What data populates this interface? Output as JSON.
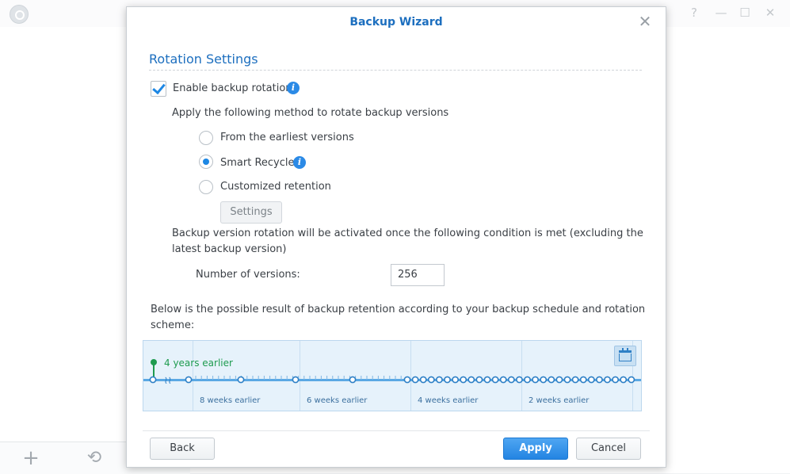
{
  "dialog": {
    "title": "Backup Wizard",
    "close_glyph": "✕",
    "section_title": "Rotation Settings",
    "enable_rotation_label": "Enable backup rotation",
    "enable_rotation_checked": true,
    "method_intro": "Apply the following method to rotate backup versions",
    "methods": [
      {
        "label": "From the earliest versions",
        "selected": false
      },
      {
        "label": "Smart Recycle",
        "selected": true
      },
      {
        "label": "Customized retention",
        "selected": false
      }
    ],
    "settings_button": "Settings",
    "condition_line1": "Backup version rotation will be activated once the following condition is met (excluding the",
    "condition_line2": "latest backup version)",
    "versions_label": "Number of versions:",
    "versions_value": "256",
    "result_line1": "Below is the possible result of backup retention according to your backup schedule and rotation",
    "result_line2": "scheme:",
    "timeline": {
      "earliest_label": "4 years earlier",
      "labels": [
        "8 weeks earlier",
        "6 weeks earlier",
        "4 weeks earlier",
        "2 weeks earlier"
      ]
    },
    "buttons": {
      "back": "Back",
      "apply": "Apply",
      "cancel": "Cancel"
    }
  },
  "background": {
    "window_controls": [
      "?",
      "—",
      "☐",
      "✕"
    ],
    "add_glyph": "+",
    "history_glyph": "⟲"
  },
  "colors": {
    "accent": "#1d6fbf",
    "primary_button": "#2384e2",
    "timeline_bg": "#e6f2fb",
    "timeline_axis": "#5aa8e4",
    "earliest_marker": "#1e9b4f"
  },
  "icons": {
    "info": "info-icon",
    "calendar": "calendar-icon",
    "close": "close-icon",
    "add": "plus-icon",
    "history": "history-icon"
  }
}
